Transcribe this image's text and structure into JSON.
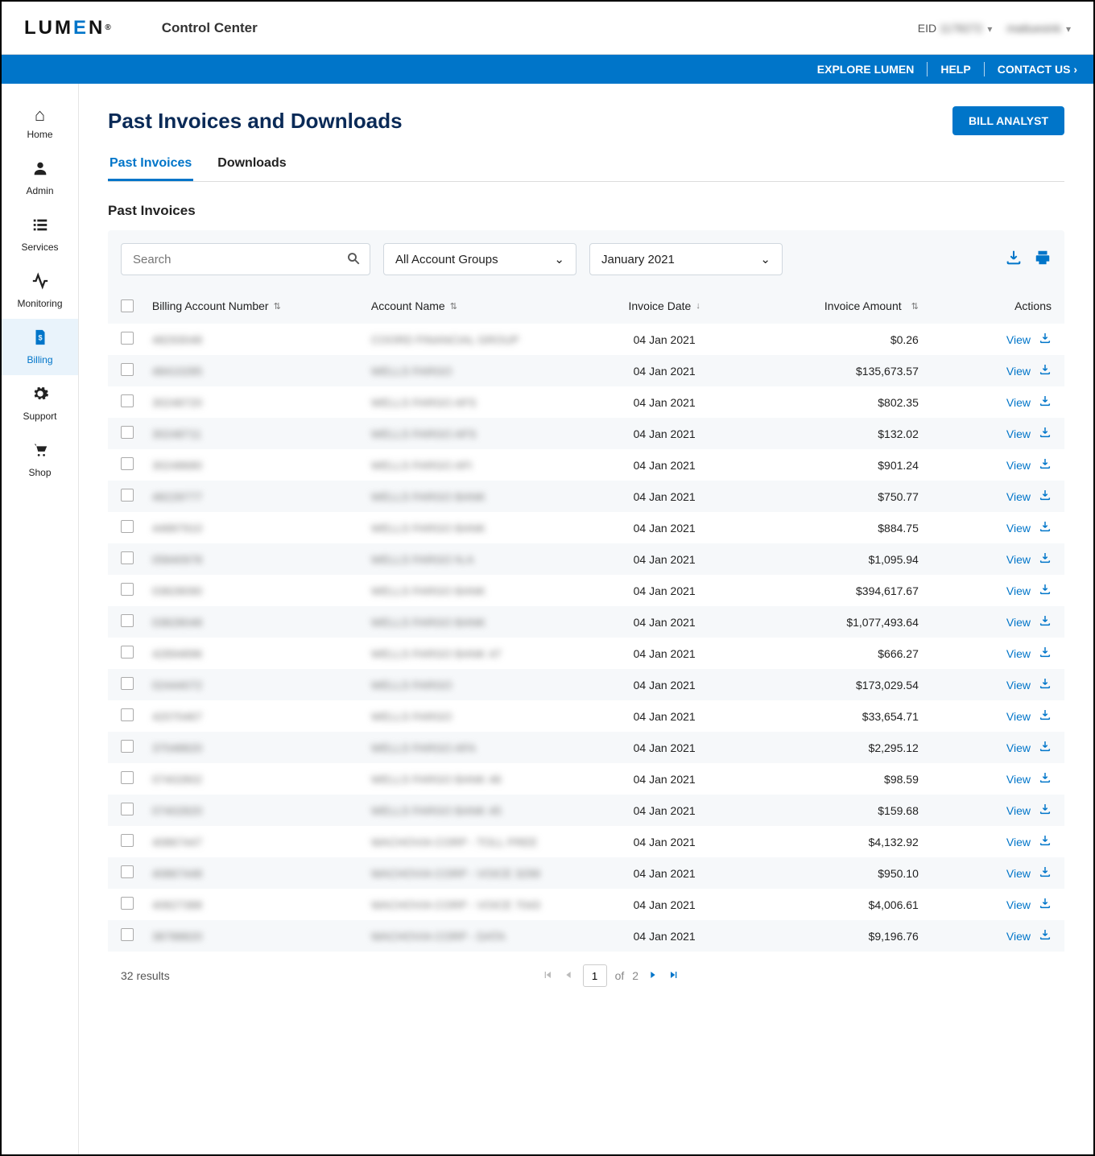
{
  "header": {
    "logo": "LUMEN",
    "app_name": "Control Center",
    "eid_label": "EID",
    "eid_value": "1178272",
    "username": "mattuesink"
  },
  "bluebar": {
    "explore": "EXPLORE LUMEN",
    "help": "HELP",
    "contact": "CONTACT US"
  },
  "sidebar": {
    "items": [
      {
        "label": "Home"
      },
      {
        "label": "Admin"
      },
      {
        "label": "Services"
      },
      {
        "label": "Monitoring"
      },
      {
        "label": "Billing"
      },
      {
        "label": "Support"
      },
      {
        "label": "Shop"
      }
    ],
    "active_index": 4
  },
  "page": {
    "title": "Past Invoices and Downloads",
    "bill_analyst_btn": "BILL ANALYST",
    "tabs": [
      {
        "label": "Past Invoices",
        "active": true
      },
      {
        "label": "Downloads",
        "active": false
      }
    ],
    "section_title": "Past Invoices"
  },
  "filters": {
    "search_placeholder": "Search",
    "account_group": "All Account Groups",
    "month": "January 2021"
  },
  "table": {
    "columns": {
      "ban": "Billing Account Number",
      "name": "Account Name",
      "date": "Invoice Date",
      "amount": "Invoice Amount",
      "actions": "Actions"
    },
    "view_label": "View",
    "rows": [
      {
        "ban": "48293048",
        "name": "COORD FINANCIAL GROUP",
        "date": "04 Jan 2021",
        "amount": "$0.26"
      },
      {
        "ban": "48410285",
        "name": "WELLS FARGO",
        "date": "04 Jan 2021",
        "amount": "$135,673.57"
      },
      {
        "ban": "30248720",
        "name": "WELLS FARGO AFS",
        "date": "04 Jan 2021",
        "amount": "$802.35"
      },
      {
        "ban": "30248711",
        "name": "WELLS FARGO AFS",
        "date": "04 Jan 2021",
        "amount": "$132.02"
      },
      {
        "ban": "30248680",
        "name": "WELLS FARGO AFI",
        "date": "04 Jan 2021",
        "amount": "$901.24"
      },
      {
        "ban": "48228777",
        "name": "WELLS FARGO BANK",
        "date": "04 Jan 2021",
        "amount": "$750.77"
      },
      {
        "ban": "44887910",
        "name": "WELLS FARGO BANK",
        "date": "04 Jan 2021",
        "amount": "$884.75"
      },
      {
        "ban": "05840978",
        "name": "WELLS FARGO N.A",
        "date": "04 Jan 2021",
        "amount": "$1,095.94"
      },
      {
        "ban": "03828090",
        "name": "WELLS FARGO BANK",
        "date": "04 Jan 2021",
        "amount": "$394,617.67"
      },
      {
        "ban": "03828048",
        "name": "WELLS FARGO BANK",
        "date": "04 Jan 2021",
        "amount": "$1,077,493.64"
      },
      {
        "ban": "42894896",
        "name": "WELLS FARGO BANK 47",
        "date": "04 Jan 2021",
        "amount": "$666.27"
      },
      {
        "ban": "02444072",
        "name": "WELLS FARGO",
        "date": "04 Jan 2021",
        "amount": "$173,029.54"
      },
      {
        "ban": "42070467",
        "name": "WELLS FARGO",
        "date": "04 Jan 2021",
        "amount": "$33,654.71"
      },
      {
        "ban": "37048820",
        "name": "WELLS FARGO AFA",
        "date": "04 Jan 2021",
        "amount": "$2,295.12"
      },
      {
        "ban": "07402802",
        "name": "WELLS FARGO BANK 46",
        "date": "04 Jan 2021",
        "amount": "$98.59"
      },
      {
        "ban": "07402820",
        "name": "WELLS FARGO BANK 45",
        "date": "04 Jan 2021",
        "amount": "$159.68"
      },
      {
        "ban": "40867447",
        "name": "WACHOVIA CORP - TOLL FREE",
        "date": "04 Jan 2021",
        "amount": "$4,132.92"
      },
      {
        "ban": "40867448",
        "name": "WACHOVIA CORP - VOICE 3299",
        "date": "04 Jan 2021",
        "amount": "$950.10"
      },
      {
        "ban": "40827388",
        "name": "WACHOVIA CORP - VOICE 7043",
        "date": "04 Jan 2021",
        "amount": "$4,006.61"
      },
      {
        "ban": "38788820",
        "name": "WACHOVIA CORP - DATA",
        "date": "04 Jan 2021",
        "amount": "$9,196.76"
      }
    ]
  },
  "pager": {
    "results": "32 results",
    "page": "1",
    "of_label": "of",
    "total": "2"
  }
}
